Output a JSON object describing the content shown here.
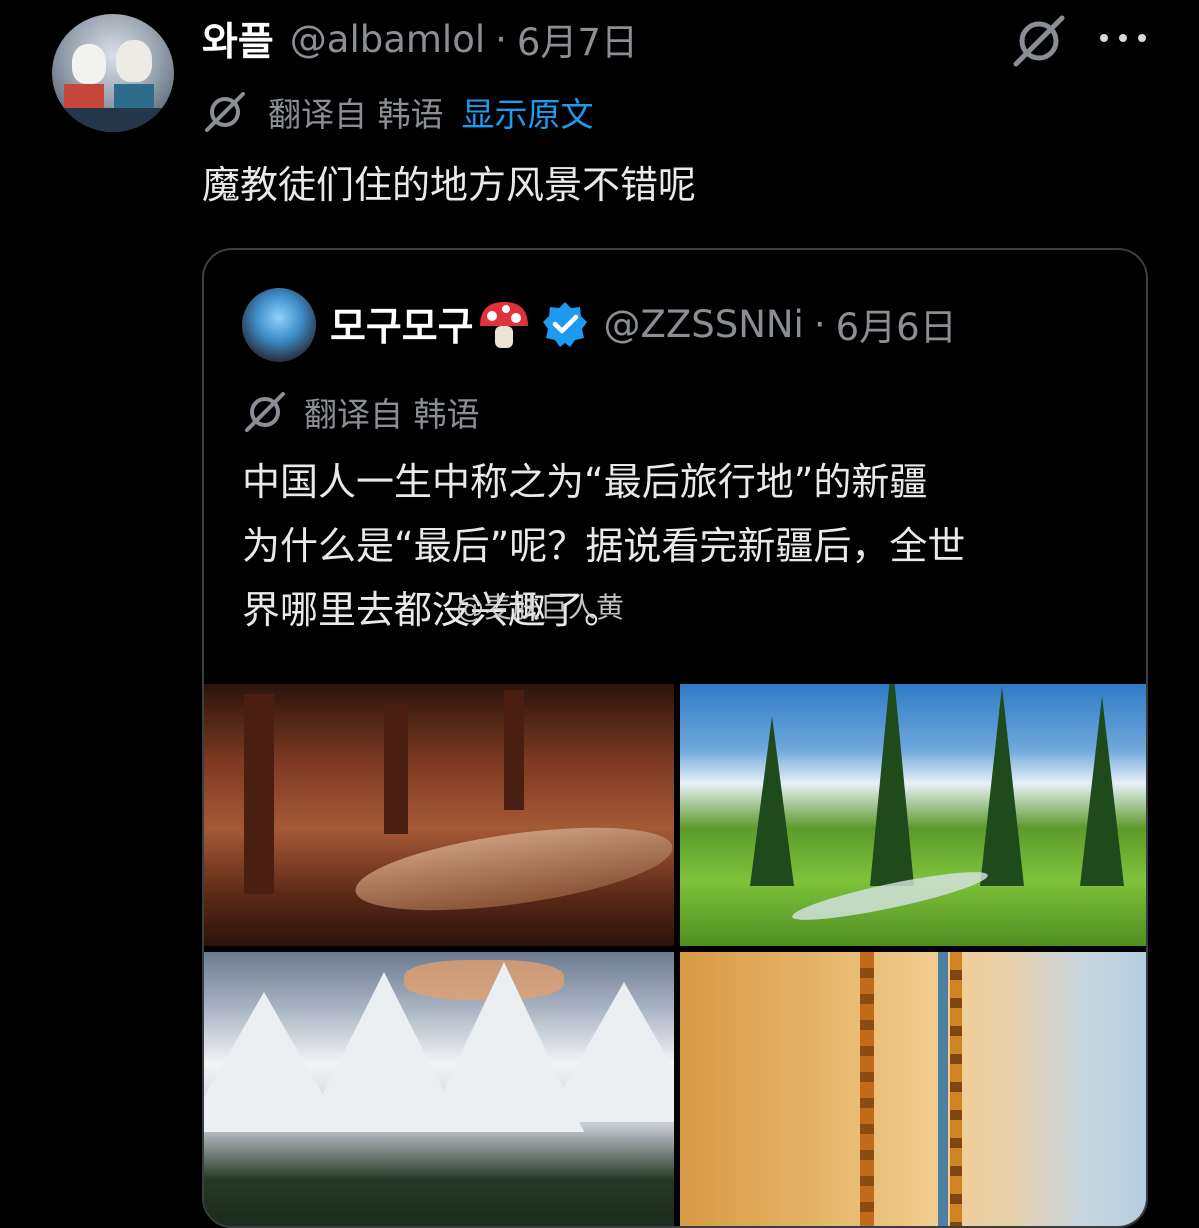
{
  "post": {
    "display_name": "와플",
    "handle": "@albamlol",
    "separator": "·",
    "date": "6月7日",
    "translated_from": "翻译自 韩语",
    "show_original": "显示原文",
    "text": "魔教徒们住的地方风景不错呢"
  },
  "quote": {
    "display_name": "모구모구",
    "handle": "@ZZSSNNi",
    "separator": "·",
    "date": "6月6日",
    "translated_from": "翻译自 韩语",
    "lines": [
      "中国人一生中称之为“最后旅行地”的新疆",
      "为什么是“最后”呢？据说看完新疆后，全世",
      "界哪里去都没兴趣了。"
    ],
    "watermark": "@麦肤巨人黄"
  },
  "icons": {
    "grok": "grok-icon",
    "more": "more-options-icon",
    "translate": "translate-icon",
    "verified": "verified-badge-icon",
    "mushroom": "mushroom-emoji"
  },
  "colors": {
    "background": "#000000",
    "link": "#1d9bf0",
    "muted": "#8b8f95",
    "verified": "#1d9bf0"
  }
}
